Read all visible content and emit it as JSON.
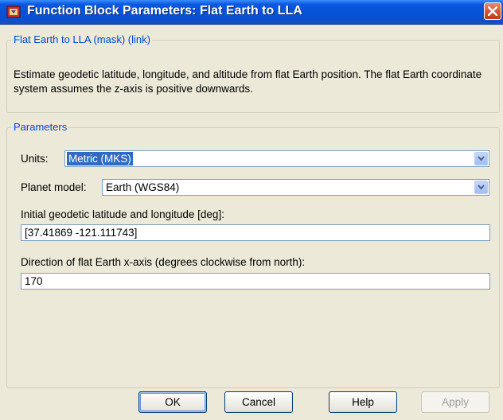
{
  "window": {
    "title": "Function Block Parameters: Flat Earth to LLA",
    "icon": "simulink-block-icon",
    "close_icon": "close-icon"
  },
  "description_group": {
    "legend": "Flat Earth to LLA (mask) (link)",
    "text": "Estimate geodetic latitude, longitude, and altitude from flat Earth position.  The flat Earth coordinate system assumes the z-axis is positive downwards."
  },
  "parameters": {
    "legend": "Parameters",
    "units": {
      "label": "Units:",
      "value": "Metric (MKS)"
    },
    "planet_model": {
      "label": "Planet model:",
      "value": "Earth (WGS84)"
    },
    "initial_lat_lon": {
      "label": "Initial geodetic latitude and longitude [deg]:",
      "value": "[37.41869 -121.111743]"
    },
    "x_axis_direction": {
      "label": "Direction of flat Earth x-axis (degrees clockwise from north):",
      "value": "170"
    }
  },
  "buttons": {
    "ok": "OK",
    "cancel": "Cancel",
    "help": "Help",
    "apply": "Apply"
  },
  "colors": {
    "title_bar": "#0553d8",
    "selection": "#316ac5",
    "legend_text": "#0046d5"
  }
}
